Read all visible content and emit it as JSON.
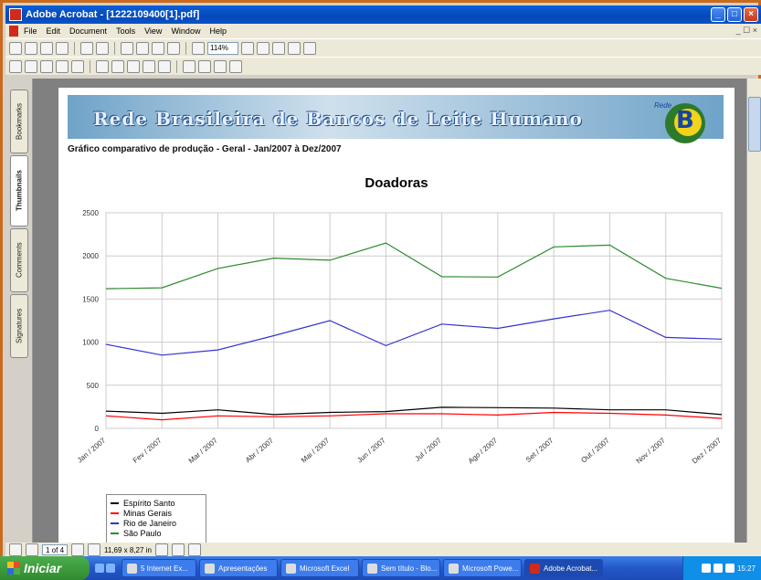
{
  "window": {
    "title": "Adobe Acrobat - [1222109400[1].pdf]",
    "min": "_",
    "max": "□",
    "close": "×"
  },
  "menu": [
    "File",
    "Edit",
    "Document",
    "Tools",
    "View",
    "Window",
    "Help"
  ],
  "mdi": "_ ☐ ×",
  "toolbar": {
    "zoom": "114%"
  },
  "navtabs": [
    "Bookmarks",
    "Thumbnails",
    "Comments",
    "Signatures"
  ],
  "banner": {
    "title": "Rede Brasileira de Bancos de Leite Humano",
    "logo_small": "Rede"
  },
  "subtitle": "Gráfico comparativo de produção - Geral - Jan/2007 à Dez/2007",
  "status": {
    "page": "1 of 4",
    "size": "11,69 x 8,27 in"
  },
  "taskbar": {
    "start": "Iniciar",
    "tasks": [
      "5 Internet Ex...",
      "Apresentações",
      "Microsoft Excel",
      "Sem título - Blo...",
      "Microsoft Powe...",
      "Adobe Acrobat..."
    ],
    "clock": "15:27"
  },
  "chart_data": {
    "type": "line",
    "title": "Doadoras",
    "categories": [
      "Jan / 2007",
      "Fev / 2007",
      "Mar / 2007",
      "Abr / 2007",
      "Mai / 2007",
      "Jun / 2007",
      "Jul / 2007",
      "Ago / 2007",
      "Set / 2007",
      "Out / 2007",
      "Nov / 2007",
      "Dez / 2007"
    ],
    "ylim": [
      0,
      2500
    ],
    "yticks": [
      "0",
      "500",
      "1000",
      "1500",
      "2000",
      "2500"
    ],
    "grid": true,
    "legend_position": "bottom-left",
    "series": [
      {
        "name": "Espírito Santo",
        "color": "#000000",
        "values": [
          200,
          175,
          215,
          160,
          185,
          195,
          245,
          240,
          235,
          215,
          215,
          160
        ]
      },
      {
        "name": "Minas Gerais",
        "color": "#ff0000",
        "values": [
          145,
          100,
          145,
          135,
          145,
          170,
          170,
          155,
          185,
          175,
          155,
          115
        ]
      },
      {
        "name": "Rio de Janeiro",
        "color": "#3333cc",
        "values": [
          975,
          850,
          910,
          1075,
          1250,
          960,
          1210,
          1160,
          1270,
          1370,
          1055,
          1035
        ]
      },
      {
        "name": "São Paulo",
        "color": "#2e8b2e",
        "values": [
          1620,
          1630,
          1855,
          1975,
          1950,
          2150,
          1760,
          1755,
          2105,
          2125,
          1740,
          1625
        ]
      }
    ]
  }
}
